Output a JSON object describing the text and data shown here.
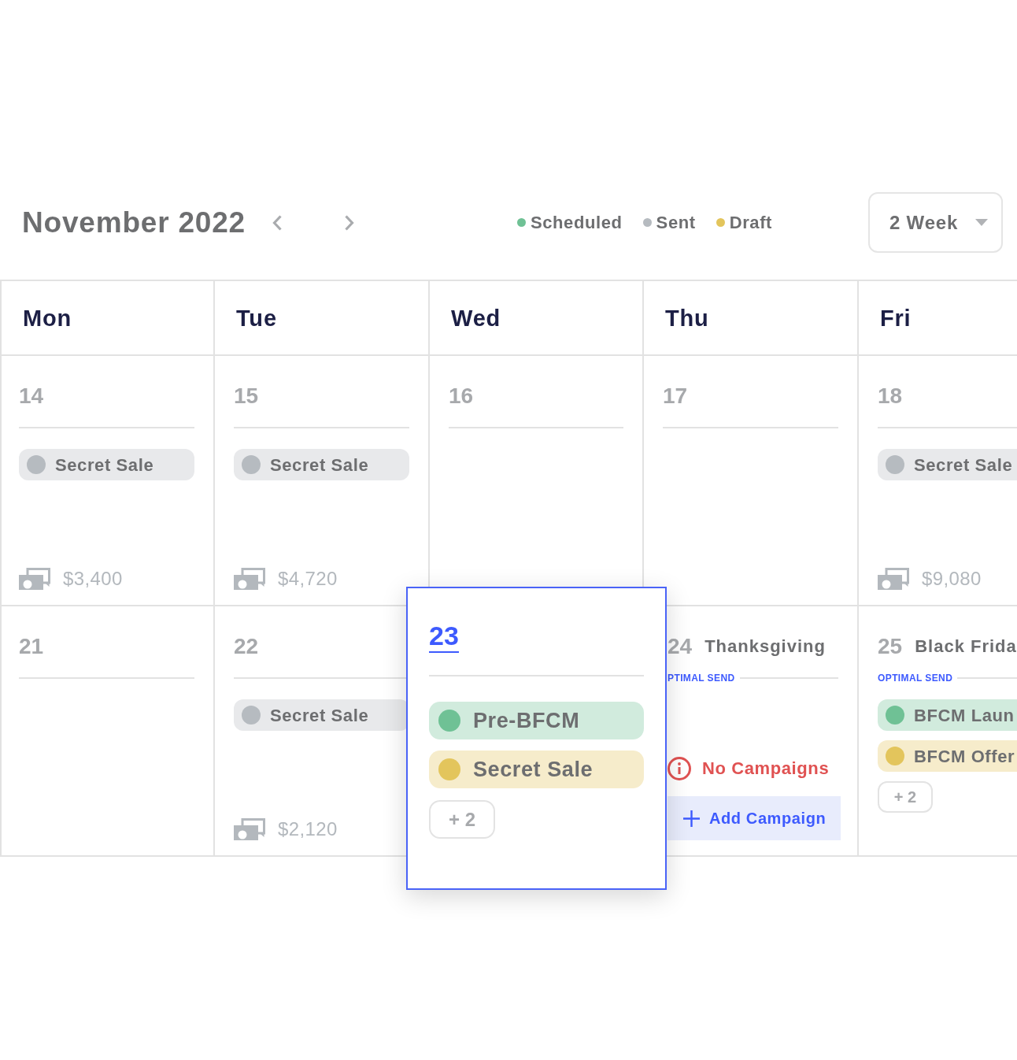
{
  "header": {
    "title": "November 2022",
    "legend": [
      {
        "label": "Scheduled",
        "color": "#6fc195"
      },
      {
        "label": "Sent",
        "color": "#b6bbc0"
      },
      {
        "label": "Draft",
        "color": "#e3c55c"
      }
    ],
    "view_select": {
      "value": "2 Week"
    }
  },
  "calendar": {
    "weekdays": [
      "Mon",
      "Tue",
      "Wed",
      "Thu",
      "Fri"
    ],
    "weeks": [
      {
        "days": [
          {
            "date": "14",
            "expanded": false,
            "campaigns": [
              {
                "name": "Secret Sale",
                "color": "#b6bbc0"
              }
            ],
            "revenue": "$3,400"
          },
          {
            "date": "15",
            "expanded": false,
            "campaigns": [
              {
                "name": "Secret Sale",
                "color": "#b6bbc0"
              }
            ],
            "revenue": "$4,720"
          },
          {
            "date": "16",
            "expanded": false
          },
          {
            "date": "17",
            "expanded": false
          },
          {
            "date": "18",
            "expanded": false,
            "campaigns": [
              {
                "name": "Secret Sale",
                "color": "#b6bbc0"
              }
            ],
            "revenue": "$9,080"
          }
        ]
      },
      {
        "days": [
          {
            "date": "21",
            "expanded": false
          },
          {
            "date": "22",
            "expanded": false,
            "campaigns": [
              {
                "name": "Secret Sale",
                "color": "#b6bbc0"
              }
            ],
            "revenue": "$2,120"
          },
          {
            "date": "23",
            "expanded": true,
            "campaigns": [
              {
                "name": "Pre-BFCM",
                "color": "#6fc195"
              },
              {
                "name": "Secret Sale",
                "color": "#e3c55c"
              }
            ],
            "more": "+ 2"
          },
          {
            "date": "24",
            "expanded": false,
            "holiday": "Thanksgiving",
            "optimal_send": "PTIMAL SEND",
            "notice": "No Campaigns",
            "add_button": "Add Campaign"
          },
          {
            "date": "25",
            "expanded": false,
            "holiday": "Black Frida",
            "optimal_send": "OPTIMAL SEND",
            "campaigns": [
              {
                "name": "BFCM Laun",
                "color": "#6fc195"
              },
              {
                "name": "BFCM Offer",
                "color": "#e3c55c"
              }
            ],
            "more": "+ 2"
          }
        ]
      }
    ]
  }
}
